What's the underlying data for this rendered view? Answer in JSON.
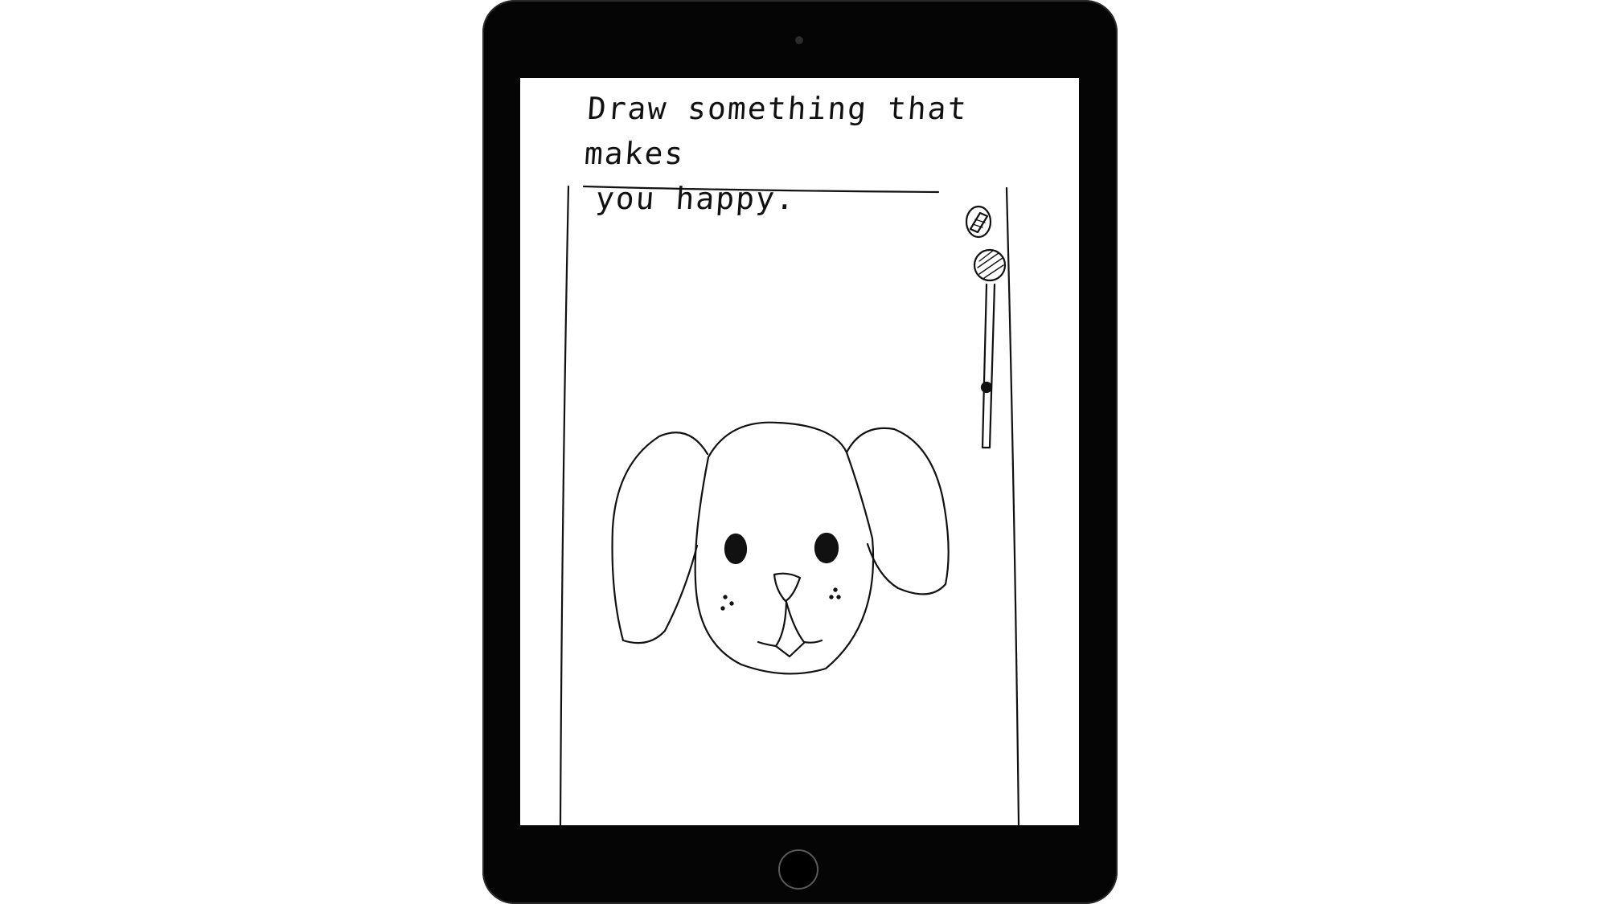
{
  "prompt": {
    "line1": "Draw something that makes",
    "line2": "you happy."
  },
  "canvas": {
    "drawing_subject": "puppy face sketch"
  },
  "tools": {
    "pen_tool_icon": "pen-nib-icon",
    "color_picker_icon": "color-dot-icon",
    "brush_size_slider_icon": "vertical-slider-icon"
  },
  "colors": {
    "device_bezel": "#050505",
    "screen_background": "#ffffff",
    "ink": "#111111"
  }
}
